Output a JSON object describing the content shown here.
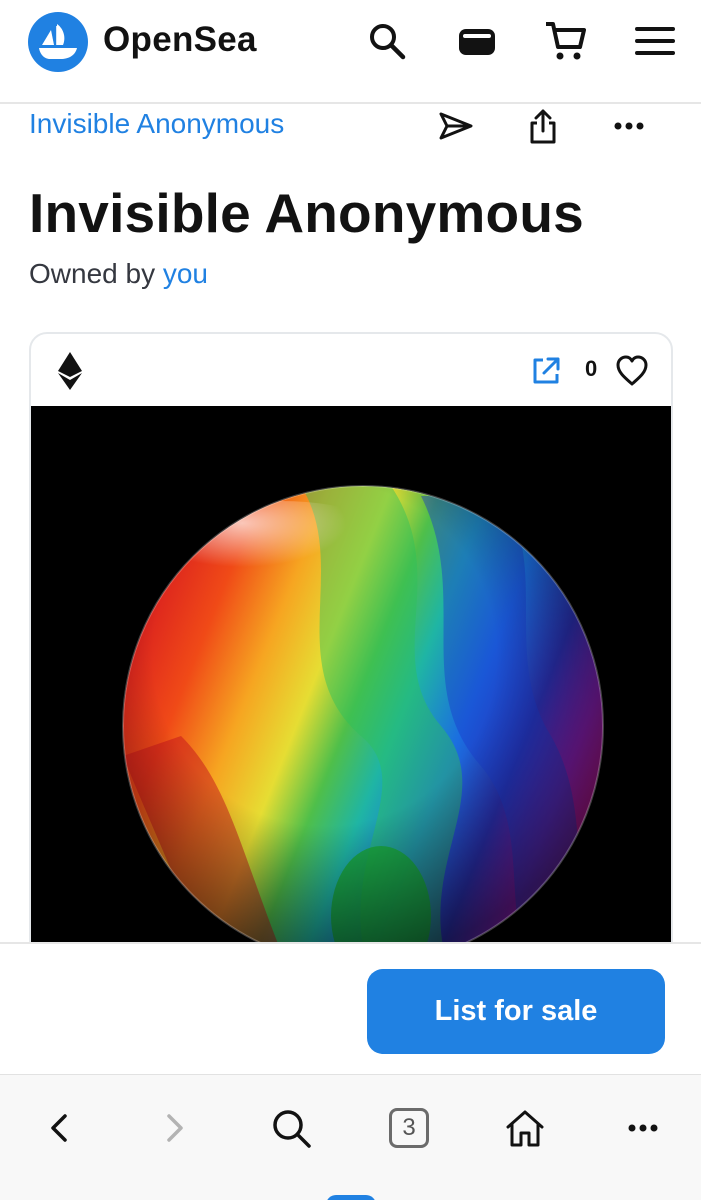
{
  "header": {
    "brand": "OpenSea",
    "icons": [
      "opensea-logo",
      "search-icon",
      "wallet-icon",
      "cart-icon",
      "menu-icon"
    ],
    "brand_color": "#2081e2"
  },
  "item": {
    "collection": "Invisible Anonymous",
    "title": "Invisible Anonymous",
    "owned_prefix": "Owned by",
    "owner": "you",
    "favorites_count": "0",
    "chain_icon": "ethereum-icon"
  },
  "actions": {
    "icons": [
      "send-icon",
      "share-icon",
      "more-icon"
    ]
  },
  "sale": {
    "button_label": "List for sale",
    "button_color": "#2081e2"
  },
  "browser": {
    "tab_count": "3",
    "icons": [
      "back-icon",
      "forward-icon",
      "search-icon",
      "tabs-icon",
      "home-icon",
      "more-icon"
    ]
  }
}
